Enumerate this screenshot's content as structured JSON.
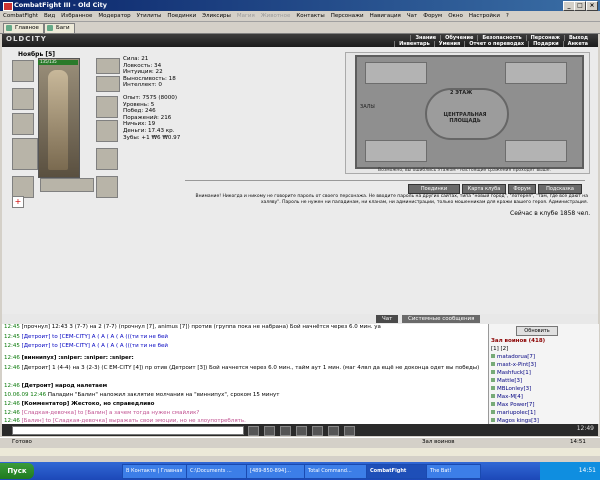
{
  "window": {
    "title": "CombatFight III - Old City"
  },
  "menu": [
    "CombatFight",
    "Вид",
    "Избранное",
    "Модератор",
    "Утилиты",
    "Поединки",
    "Эликсиры",
    "Магия",
    "Животное",
    "Контакты",
    "Персонажи",
    "Навигация",
    "Чат",
    "Форум",
    "Окно",
    "Настройки",
    "?"
  ],
  "tabs": [
    "Главное",
    "Баги"
  ],
  "header": {
    "logo": "OLDCITY",
    "nav_top": [
      "Знание",
      "Обучение",
      "Безопасность",
      "Персонаж",
      "Выход"
    ],
    "nav_bottom": [
      "Инвентарь",
      "Умения",
      "Отчет о переводах",
      "Подарки",
      "Анкета"
    ]
  },
  "character": {
    "name": "Ноябрь [5]",
    "hp": "135/135",
    "stats": [
      "Сила: 21",
      "Ловкость: 34",
      "Интуиция: 22",
      "Выносливость: 18",
      "Интеллект: 0",
      "",
      "Опыт: 7575 (8000)",
      "Уровень: 5",
      "Побед: 246",
      "Поражений: 216",
      "Ничьих: 19",
      "Деньги: 17.43 кр.",
      "Зубы: +1 ₩6 ₩0.97"
    ]
  },
  "map": {
    "center": "ЦЕНТРАЛЬНАЯ ПЛОЩАДЬ",
    "floor": "2 ЭТАЖ",
    "hall": "ЗАЛЫ",
    "caption": "Возможно, вы ошиблись этажом - настоящие сражения проходят выше."
  },
  "buttons": [
    "Поединки",
    "Карта клуба",
    "Форум",
    "Подсказка"
  ],
  "warning": "Внимание! Никогда и никому не говорите пароль от своего персонажа. Не вводите пароль на других сайтах, типа \"новый город\", \"лотерея\", \"там, где все дают на халяву\". Пароль не нужен ни паладинам, ни кланам, ни администрации, только мошенникам для кражи вашего героя. Администрация.",
  "online": "Сейчас в клубе 1858 чел.",
  "chat_tabs": [
    "Чат",
    "Системные сообщения"
  ],
  "chat": [
    {
      "time": "12:45",
      "text": "[прочнул] 12:43 3 (7-7) на 2 (7-7) (прочнул [7], animus [7]) против (группа пока не набрана) Бой начнётся через 6.0 мин. уа"
    },
    {
      "time": "12:45",
      "text": "[Детроит] to [CEM-CITY] А ( А ( А ( А (((ти ти не бей"
    },
    {
      "time": "12:45",
      "text": "[Детроит] to [CEM-CITY] А ( А ( А ( А (((ти ти не бей"
    },
    {
      "time": "12:46",
      "text": "[виннипух] :sniper: :sniper: :sniper:"
    },
    {
      "time": "12:46",
      "text": "[Детроит] 1 (4-4) на 3 (2-3) (С EM-CITY [4]) пр отив (Детроит [3]) Бой начнется через 6.0 мин., тайм аут 1 мин. (маг 4лвл да ещё не доконца одет вы победы)"
    },
    {
      "time": "12:46",
      "text": "[Детроит] народ налетаем"
    },
    {
      "time": "10.06.09 12:46",
      "text": "Паладин \"Балин\" наложил заклятие молчания на \"виннипух\", сроком 15 минут"
    },
    {
      "time": "12:46",
      "text": "[Комментатор] Жестоко, но справедливо"
    },
    {
      "time": "12:46",
      "text": "[Сладкая-девочка] to [Балин] а зачем тогда нужен смайлик?"
    },
    {
      "time": "12:46",
      "text": "[Балин] to [Сладкая-девочка] выражать свои эмоции, но не злоупотреблять."
    },
    {
      "time": "12:46",
      "text": "[Сладкая-девочка] to [Балин] а может у других так много эмоций?"
    }
  ],
  "side": {
    "refresh": "Обновить",
    "warriors_title": "Зал воинов (418)",
    "pages": "[1] [2]",
    "players": [
      "matadorua[7]",
      "mast-x-Pint[3]",
      "Mashfuck[1]",
      "Mattle[3]",
      "MBLonley[3]",
      "Max-M[4]",
      "Max Power[7]",
      "mariupolec[1]",
      "Magos kings[3]",
      "magnishe[3]"
    ]
  },
  "clock": "12:49",
  "status": {
    "left": "Готово",
    "middle": "Зал воинов",
    "right": "14:51"
  },
  "taskbar": {
    "start": "Пуск",
    "tasks": [
      "В Контакте | Главная",
      "C:\\Documents ...",
      "[489-850-894]...",
      "Total Command...",
      "CombatFight",
      "The Bat!"
    ],
    "active_index": 4,
    "clock": "14:51"
  }
}
